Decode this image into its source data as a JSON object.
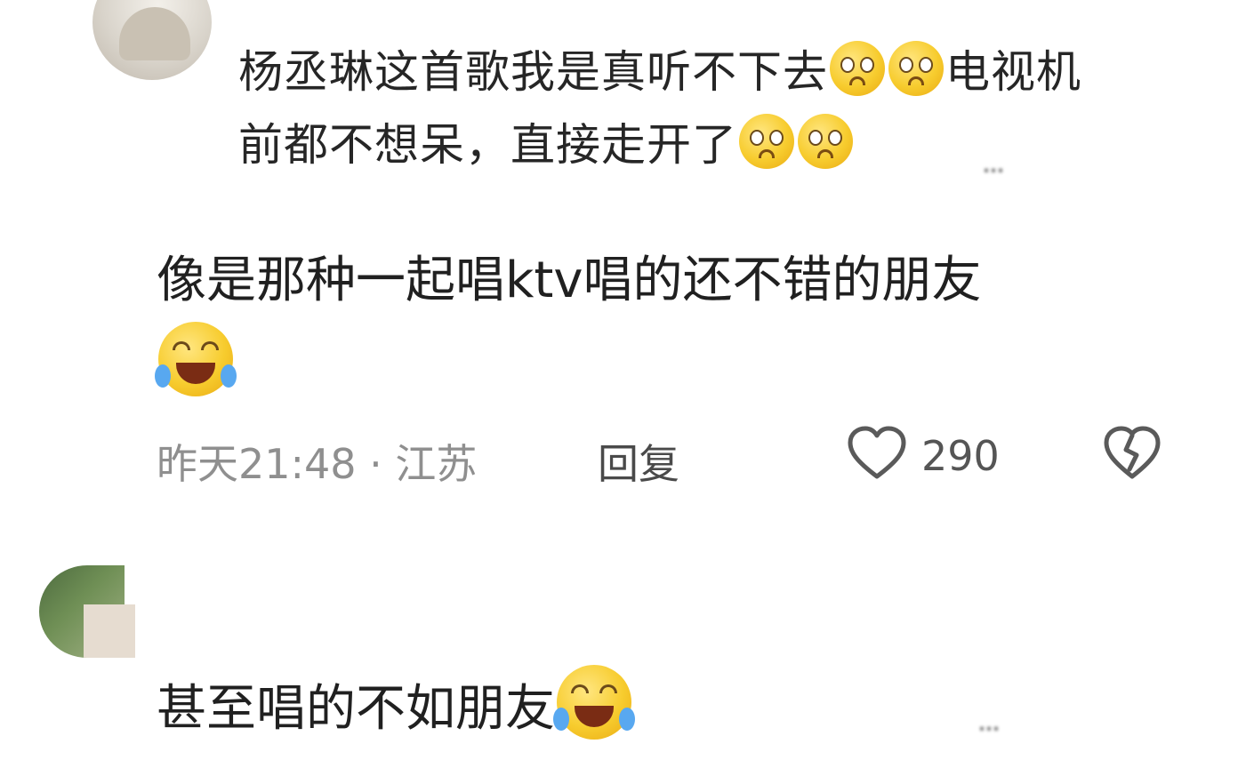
{
  "comments": {
    "first_partial": {
      "text_line1": "杨丞琳这首歌我是真听不下去",
      "text_line1_suffix": "电视机",
      "text_line2": "前都不想呆，直接走开了",
      "tag": "…"
    },
    "reply": {
      "text_line1": "像是那种一起唱ktv唱的还不错的朋友",
      "time_location": "昨天21:48 · 江苏",
      "reply_label": "回复",
      "likes": "290"
    },
    "second": {
      "text": "甚至唱的不如朋友",
      "tag": "…"
    }
  },
  "icons": {
    "heart": "heart-outline-icon",
    "dislike": "broken-heart-icon",
    "emoji_pleading": "pleading-face-icon",
    "emoji_laugh": "laughing-tears-icon"
  }
}
